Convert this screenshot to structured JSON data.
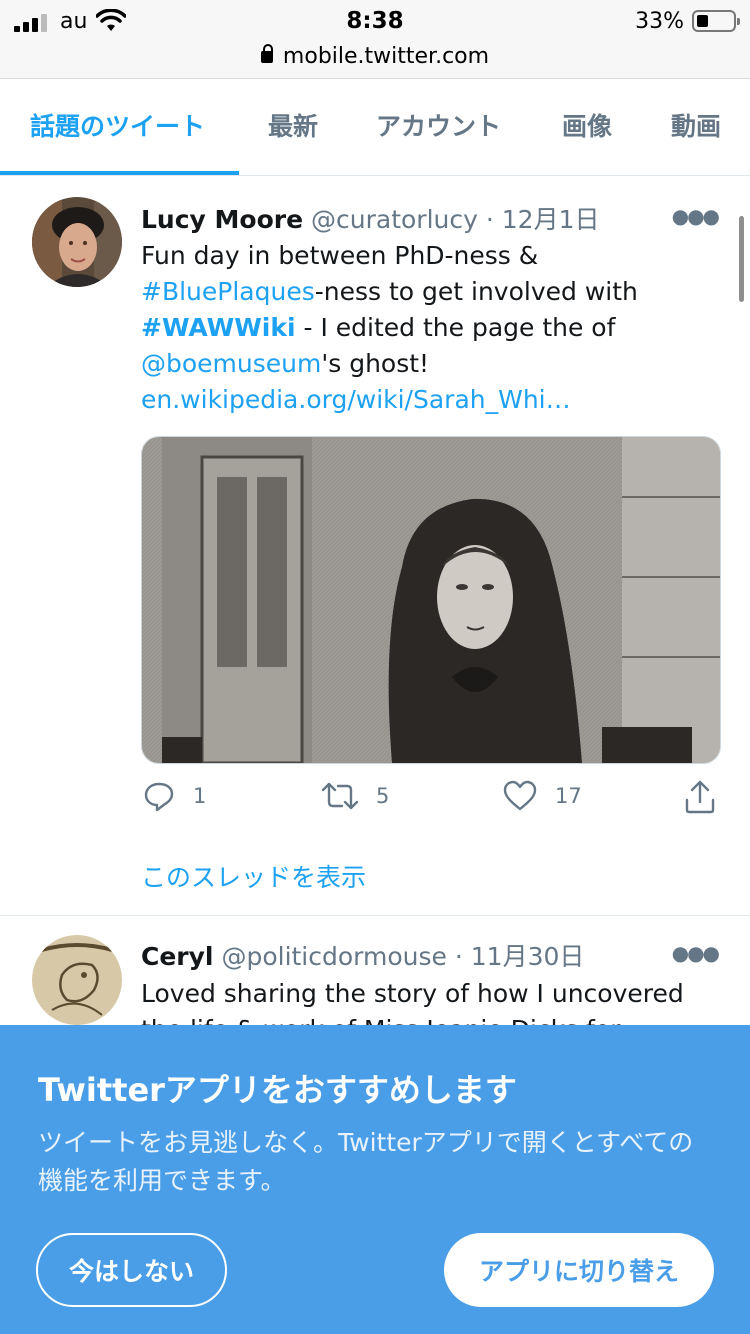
{
  "status_bar": {
    "carrier": "au",
    "time": "8:38",
    "battery": "33%"
  },
  "browser": {
    "url": "mobile.twitter.com"
  },
  "tabs": [
    {
      "label": "話題のツイート",
      "active": true
    },
    {
      "label": "最新"
    },
    {
      "label": "アカウント"
    },
    {
      "label": "画像"
    },
    {
      "label": "動画"
    }
  ],
  "tweets": [
    {
      "name": "Lucy Moore",
      "handle": "@curatorlucy",
      "sep": "·",
      "date": "12月1日",
      "text": {
        "l1": "Fun day in between PhD-ness &",
        "tag1": "#BluePlaques",
        "l2b": "-ness to get involved with",
        "tag2": "#WAWWiki",
        "l3b": " - I edited the page the of",
        "mention": "@boemuseum",
        "l4b": "'s ghost!",
        "link": "en.wikipedia.org/wiki/Sarah_Whi…"
      },
      "replies": "1",
      "retweets": "5",
      "likes": "17",
      "show_thread": "このスレッドを表示"
    },
    {
      "name": "Ceryl",
      "handle": "@politicdormouse",
      "sep": "·",
      "date": "11月30日",
      "text": {
        "l1": "Loved sharing the story of how I uncovered",
        "l2": "the life & work of Miss Jeanie Dicks for"
      }
    }
  ],
  "banner": {
    "title": "Twitterアプリをおすすめします",
    "description": "ツイートをお見逃しなく。Twitterアプリで開くとすべての機能を利用できます。",
    "not_now": "今はしない",
    "switch_app": "アプリに切り替え"
  }
}
